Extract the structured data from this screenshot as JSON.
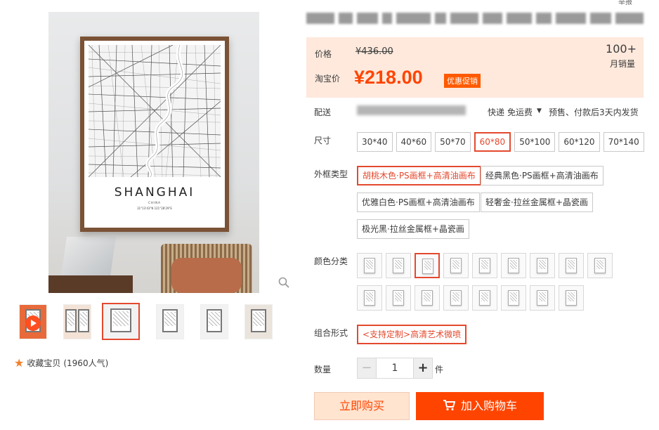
{
  "header": {
    "corner_text": "举报"
  },
  "gallery": {
    "poster_city": "SHANGHAI",
    "poster_country": "CHINA",
    "poster_coords": "31°13'43\"N  121°28'29\"E",
    "thumbnails": [
      "video",
      "img2",
      "img3",
      "img4",
      "img5",
      "img6"
    ],
    "selected_thumbnail": 3,
    "favorite_text": "收藏宝贝",
    "favorite_count": "(1960人气)"
  },
  "price": {
    "price_label": "价格",
    "original_price": "¥436.00",
    "taobao_label": "淘宝价",
    "current_price": "¥218.00",
    "promo_badge": "优惠促销",
    "sales_count": "100+",
    "sales_label": "月销量"
  },
  "shipping": {
    "label": "配送",
    "express": "快递",
    "fee": "免运费",
    "presale_note": "预售、付款后3天内发货"
  },
  "size": {
    "label": "尺寸",
    "options": [
      "30*40",
      "40*60",
      "50*70",
      "60*80",
      "50*100",
      "60*120",
      "70*140"
    ],
    "selected": "60*80"
  },
  "frame": {
    "label": "外框类型",
    "options": [
      "胡桃木色·PS画框+高清油画布",
      "经典黑色·PS画框+高清油画布",
      "优雅白色·PS画框+高清油画布",
      "轻奢金·拉丝金属框+晶瓷画",
      "极光黑·拉丝金属框+晶瓷画"
    ],
    "selected": "胡桃木色·PS画框+高清油画布"
  },
  "color": {
    "label": "颜色分类",
    "selected_index": 2
  },
  "combo": {
    "label": "组合形式",
    "options": [
      "<支持定制>高清艺术微喷"
    ]
  },
  "quantity": {
    "label": "数量",
    "value": "1",
    "unit": "件",
    "minus": "−",
    "plus": "+"
  },
  "actions": {
    "buy_now": "立即购买",
    "add_to_cart": "加入购物车"
  },
  "colors": {
    "accent": "#ff4400",
    "selected_border": "#e4492e",
    "price_bg": "#fee9dc"
  }
}
